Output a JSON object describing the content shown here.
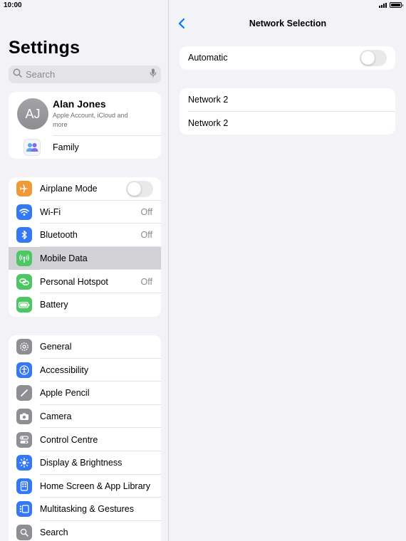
{
  "status": {
    "time": "10:00"
  },
  "sidebar": {
    "title": "Settings",
    "search": {
      "placeholder": "Search"
    },
    "account": {
      "initials": "AJ",
      "name": "Alan Jones",
      "subtitle": "Apple Account, iCloud and more",
      "family_label": "Family"
    },
    "group1": [
      {
        "label": "Airplane Mode",
        "icon": "airplane-icon",
        "color": "#f09a37",
        "toggle": false
      },
      {
        "label": "Wi-Fi",
        "icon": "wifi-icon",
        "color": "#3478f6",
        "value": "Off"
      },
      {
        "label": "Bluetooth",
        "icon": "bluetooth-icon",
        "color": "#3478f6",
        "value": "Off"
      },
      {
        "label": "Mobile Data",
        "icon": "antenna-icon",
        "color": "#4cc764",
        "selected": true
      },
      {
        "label": "Personal Hotspot",
        "icon": "hotspot-icon",
        "color": "#4cc764",
        "value": "Off"
      },
      {
        "label": "Battery",
        "icon": "battery-icon",
        "color": "#4cc764"
      }
    ],
    "group2": [
      {
        "label": "General",
        "icon": "gear-icon",
        "color": "#8e8e93"
      },
      {
        "label": "Accessibility",
        "icon": "accessibility-icon",
        "color": "#3478f6"
      },
      {
        "label": "Apple Pencil",
        "icon": "pencil-icon",
        "color": "#8e8e93"
      },
      {
        "label": "Camera",
        "icon": "camera-icon",
        "color": "#8e8e93"
      },
      {
        "label": "Control Centre",
        "icon": "control-centre-icon",
        "color": "#8e8e93"
      },
      {
        "label": "Display & Brightness",
        "icon": "sun-icon",
        "color": "#3478f6"
      },
      {
        "label": "Home Screen & App Library",
        "icon": "home-screen-icon",
        "color": "#3478f6"
      },
      {
        "label": "Multitasking & Gestures",
        "icon": "multitasking-icon",
        "color": "#3478f6"
      },
      {
        "label": "Search",
        "icon": "search-icon",
        "color": "#8e8e93"
      }
    ]
  },
  "detail": {
    "title": "Network Selection",
    "automatic_label": "Automatic",
    "automatic_on": false,
    "networks": [
      "Network 2",
      "Network 2"
    ]
  },
  "colors": {
    "accent": "#007aff",
    "selected_row": "#d1d1d6",
    "background": "#f2f2f7"
  }
}
